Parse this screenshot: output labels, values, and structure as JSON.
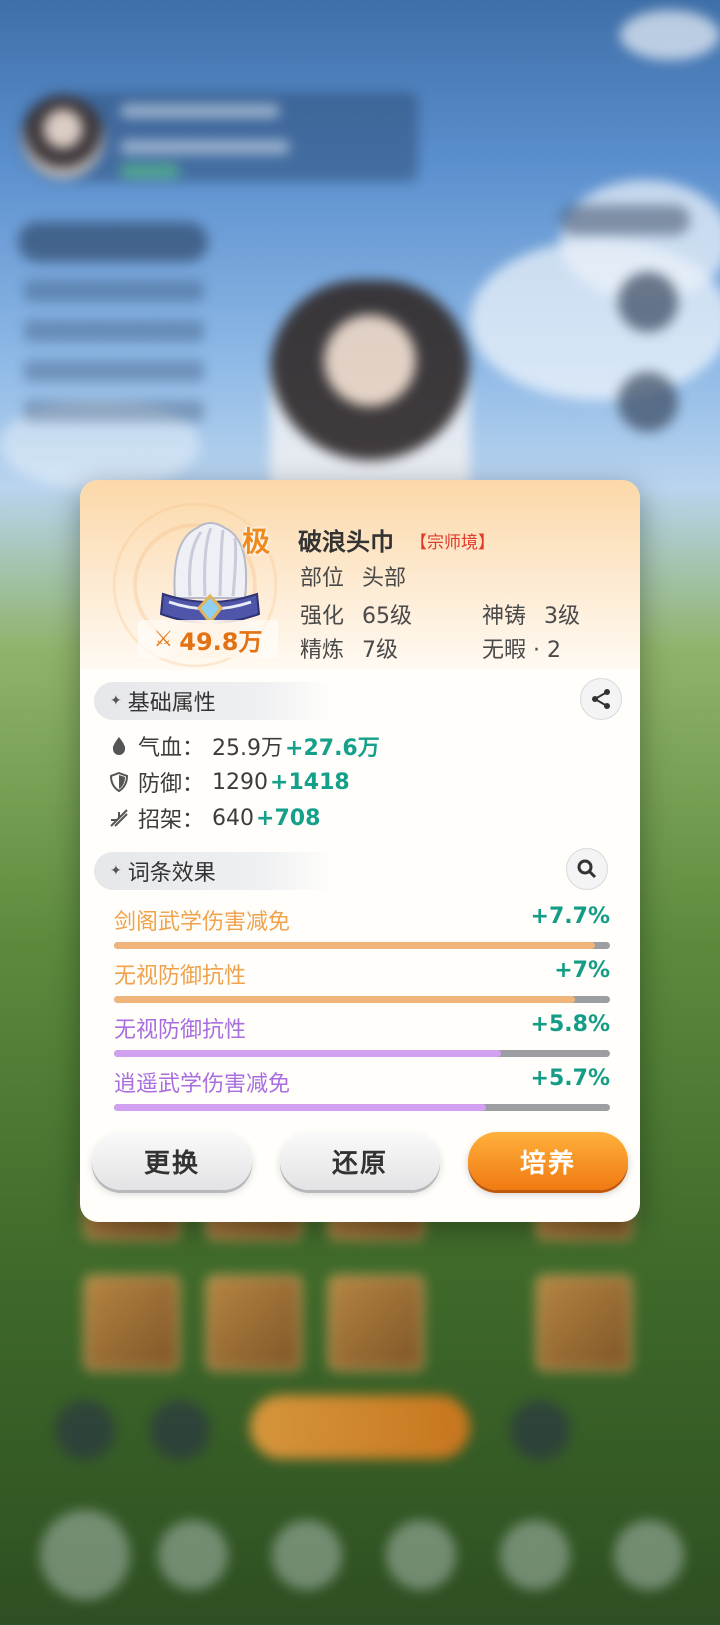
{
  "equipment": {
    "grade_badge": "极",
    "power_icon": "crossed-swords-icon",
    "power_value": "49.8万",
    "name": "破浪头巾",
    "realm": "【宗师境】",
    "slot_key": "部位",
    "slot_value": "头部",
    "enhance_key": "强化",
    "enhance_value": "65级",
    "divine_key": "神铸",
    "divine_value": "3级",
    "refine_key": "精炼",
    "refine_value": "7级",
    "flawless": "无暇 · 2"
  },
  "base_section": {
    "title": "基础属性",
    "stats": [
      {
        "icon": "drop-icon",
        "label": "气血：",
        "value": "25.9万",
        "bonus": "+27.6万"
      },
      {
        "icon": "shield-icon",
        "label": "防御：",
        "value": "1290",
        "bonus": "+1418"
      },
      {
        "icon": "parry-icon",
        "label": "招架：",
        "value": "640",
        "bonus": "+708"
      }
    ]
  },
  "affix_section": {
    "title": "词条效果",
    "affixes": [
      {
        "name": "剑阁武学伤害减免",
        "value": "+7.7%",
        "fill_percent": 0.97,
        "color": "#f0a24c",
        "bar_color": "#efb57a"
      },
      {
        "name": "无视防御抗性",
        "value": "+7%",
        "fill_percent": 0.93,
        "color": "#f0a24c",
        "bar_color": "#efb57a"
      },
      {
        "name": "无视防御抗性",
        "value": "+5.8%",
        "fill_percent": 0.78,
        "color": "#a86ee0",
        "bar_color": "#d2a0f0"
      },
      {
        "name": "逍遥武学伤害减免",
        "value": "+5.7%",
        "fill_percent": 0.75,
        "color": "#a86ee0",
        "bar_color": "#d2a0f0"
      }
    ]
  },
  "buttons": {
    "replace": "更换",
    "restore": "还原",
    "cultivate": "培养"
  }
}
